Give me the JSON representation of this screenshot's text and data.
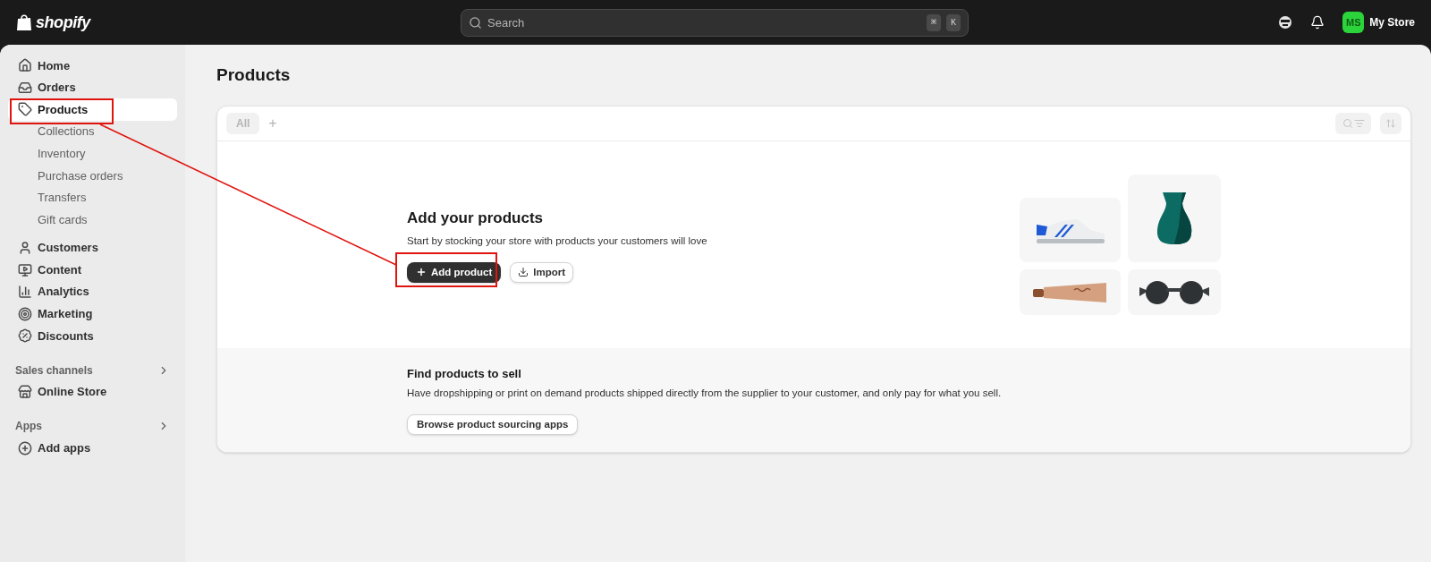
{
  "topbar": {
    "logo": "shopify",
    "search": {
      "placeholder": "Search",
      "shortcut": [
        "⌘",
        "K"
      ]
    },
    "store": {
      "initials": "MS",
      "name": "My Store"
    }
  },
  "sidebar": {
    "items": [
      {
        "label": "Home",
        "selected": false
      },
      {
        "label": "Orders",
        "selected": false
      },
      {
        "label": "Products",
        "selected": true,
        "children": [
          {
            "label": "Collections",
            "selected": false
          },
          {
            "label": "Inventory",
            "selected": false
          },
          {
            "label": "Purchase orders",
            "selected": false
          },
          {
            "label": "Transfers",
            "selected": false
          },
          {
            "label": "Gift cards",
            "selected": false
          }
        ]
      },
      {
        "label": "Customers",
        "selected": false
      },
      {
        "label": "Content",
        "selected": false
      },
      {
        "label": "Analytics",
        "selected": false
      },
      {
        "label": "Marketing",
        "selected": false
      },
      {
        "label": "Discounts",
        "selected": false
      }
    ],
    "sections": [
      {
        "title": "Sales channels",
        "items": [
          {
            "label": "Online Store",
            "selected": false
          }
        ]
      },
      {
        "title": "Apps",
        "items": [
          {
            "label": "Add apps",
            "selected": false
          }
        ]
      }
    ]
  },
  "page": {
    "title": "Products",
    "tabs": [
      {
        "label": "All",
        "selected": true
      }
    ],
    "add_tab": "+"
  },
  "empty_state": {
    "title": "Add your products",
    "description": "Start by stocking your store with products your customers will love",
    "buttons": [
      {
        "label": "Add product",
        "kind": "primary"
      },
      {
        "label": "Import",
        "kind": "secondary"
      }
    ]
  },
  "sourcing": {
    "title": "Find products to sell",
    "description": "Have dropshipping or print on demand products shipped directly from the supplier to your customer, and only pay for what you sell.",
    "button": "Browse product sourcing apps"
  }
}
